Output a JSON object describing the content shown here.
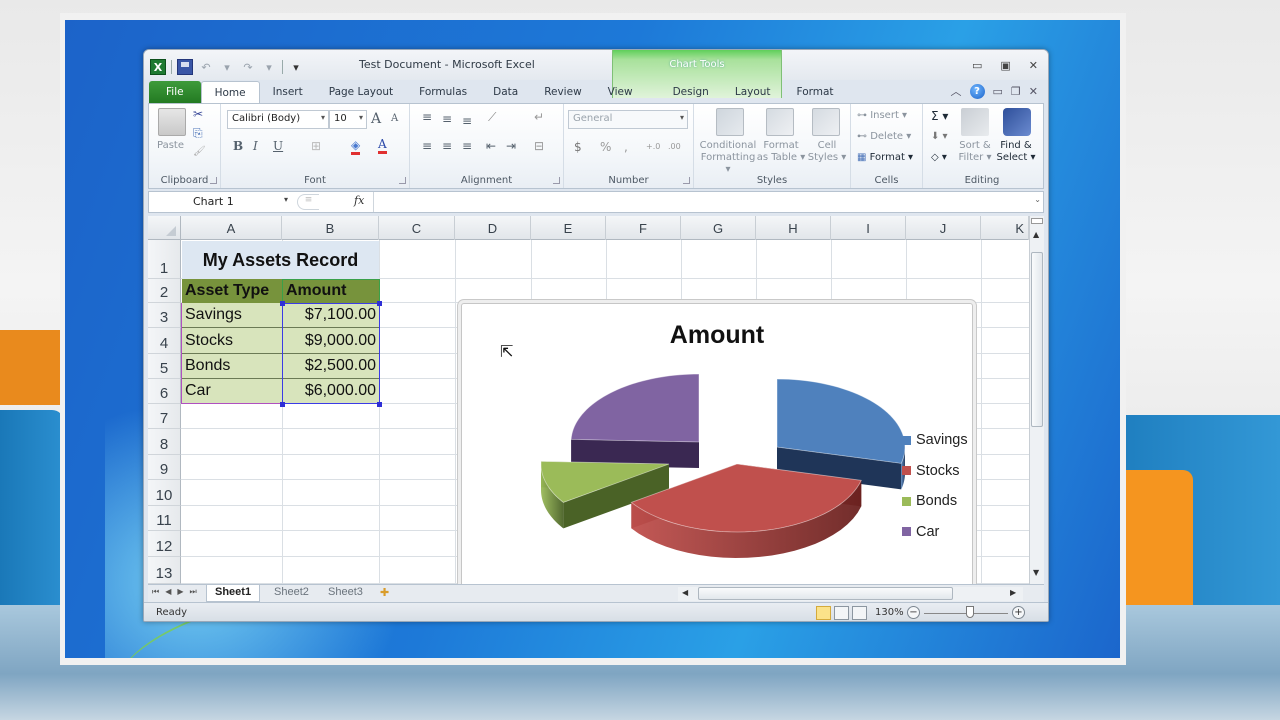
{
  "window": {
    "title": "Test Document  -  Microsoft Excel",
    "controls": {
      "minimize": "▭",
      "restore": "▣",
      "close": "✕"
    },
    "doc_controls": {
      "collapse": "︿",
      "help": "?",
      "minimize": "▭",
      "restore": "❐",
      "close": "✕"
    }
  },
  "qat": {
    "logo": "X",
    "undo": "↶",
    "redo": "↷",
    "customize": "▾"
  },
  "tabs": {
    "file": "File",
    "items": [
      "Home",
      "Insert",
      "Page Layout",
      "Formulas",
      "Data",
      "Review",
      "View"
    ],
    "active": "Home",
    "context_header": "Chart Tools",
    "context_tabs": [
      "Design",
      "Layout",
      "Format"
    ]
  },
  "ribbon": {
    "clipboard": {
      "label": "Clipboard",
      "paste": "Paste",
      "cut_icon": "✂",
      "copy_icon": "⎘",
      "painter_icon": "🖌"
    },
    "font": {
      "label": "Font",
      "family": "Calibri (Body)",
      "size": "10",
      "grow": "A",
      "shrink": "A",
      "bold": "B",
      "italic": "I",
      "underline": "U",
      "borders": "⊞",
      "fill_icon": "◈",
      "color_icon": "A",
      "fill_color": "#e03030",
      "font_color": "#e03030"
    },
    "alignment": {
      "label": "Alignment",
      "top": "≡",
      "middle": "≡",
      "bottom": "≡",
      "orient": "⟋",
      "left": "≡",
      "center": "≡",
      "right": "≡",
      "dec_indent": "⇤",
      "inc_indent": "⇥",
      "wrap": "↵",
      "merge": "⊟"
    },
    "number": {
      "label": "Number",
      "format": "General",
      "currency": "$",
      "percent": "%",
      "comma": ",",
      "inc_dec": "+.0",
      "dec_dec": ".00"
    },
    "styles": {
      "label": "Styles",
      "conditional": [
        "Conditional",
        "Formatting ▾"
      ],
      "format_table": [
        "Format",
        "as Table ▾"
      ],
      "cell_styles": [
        "Cell",
        "Styles ▾"
      ]
    },
    "cells": {
      "label": "Cells",
      "insert": "Insert ▾",
      "delete": "Delete ▾",
      "format": "Format ▾"
    },
    "editing": {
      "label": "Editing",
      "autosum": "Σ ▾",
      "fill": "⬇ ▾",
      "clear": "◇ ▾",
      "sort": [
        "Sort &",
        "Filter ▾"
      ],
      "find": [
        "Find &",
        "Select ▾"
      ]
    }
  },
  "formula_bar": {
    "name_box": "Chart 1",
    "fx": "fx",
    "value": ""
  },
  "grid": {
    "columns": [
      "A",
      "B",
      "C",
      "D",
      "E",
      "F",
      "G",
      "H",
      "I",
      "J",
      "K"
    ],
    "rows": [
      "1",
      "2",
      "3",
      "4",
      "5",
      "6",
      "7",
      "8",
      "9",
      "10",
      "11",
      "12",
      "13"
    ],
    "title": "My Assets Record",
    "headers": [
      "Asset Type",
      "Amount"
    ],
    "records": [
      {
        "type": "Savings",
        "amount": "$7,100.00"
      },
      {
        "type": "Stocks",
        "amount": "$9,000.00"
      },
      {
        "type": "Bonds",
        "amount": "$2,500.00"
      },
      {
        "type": "Car",
        "amount": "$6,000.00"
      }
    ]
  },
  "chart_data": {
    "type": "pie",
    "variant": "3-D exploded pie",
    "title": "Amount",
    "categories": [
      "Savings",
      "Stocks",
      "Bonds",
      "Car"
    ],
    "values": [
      7100,
      9000,
      2500,
      6000
    ],
    "colors": [
      "#4f81bd",
      "#c0504d",
      "#9bbb59",
      "#8064a2"
    ],
    "dark_colors": [
      "#1f3558",
      "#6b2220",
      "#4a6226",
      "#3a2852"
    ],
    "legend_position": "right"
  },
  "sheets": {
    "tabs": [
      "Sheet1",
      "Sheet2",
      "Sheet3"
    ],
    "active": "Sheet1",
    "nav": [
      "⏮",
      "◀",
      "▶",
      "⏭"
    ]
  },
  "status": {
    "text": "Ready",
    "zoom": "130%",
    "zoom_minus": "−",
    "zoom_plus": "+"
  }
}
